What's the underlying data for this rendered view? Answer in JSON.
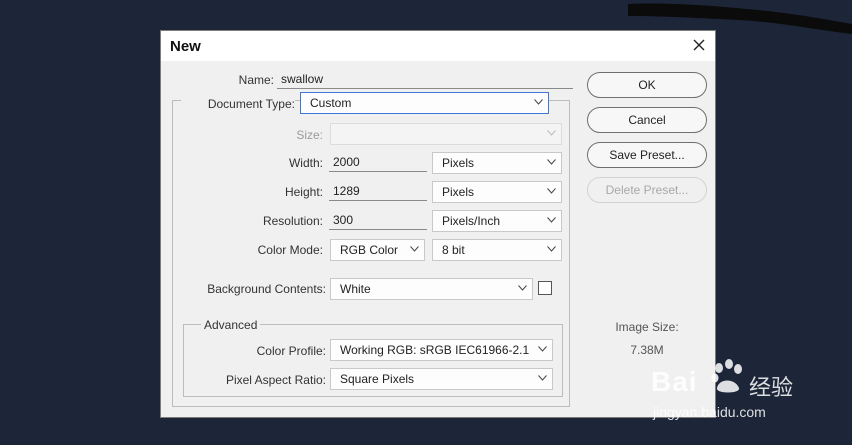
{
  "dialog": {
    "title": "New",
    "name_label": "Name:",
    "name_value": "swallow",
    "document_type_label": "Document Type:",
    "document_type_value": "Custom",
    "size_label": "Size:",
    "size_value": "",
    "width_label": "Width:",
    "width_value": "2000",
    "width_unit": "Pixels",
    "height_label": "Height:",
    "height_value": "1289",
    "height_unit": "Pixels",
    "resolution_label": "Resolution:",
    "resolution_value": "300",
    "resolution_unit": "Pixels/Inch",
    "color_mode_label": "Color Mode:",
    "color_mode_value": "RGB Color",
    "bit_depth_value": "8 bit",
    "background_label": "Background Contents:",
    "background_value": "White",
    "advanced_label": "Advanced",
    "color_profile_label": "Color Profile:",
    "color_profile_value": "Working RGB:  sRGB IEC61966-2.1",
    "pixel_aspect_label": "Pixel Aspect Ratio:",
    "pixel_aspect_value": "Square Pixels"
  },
  "buttons": {
    "ok": "OK",
    "cancel": "Cancel",
    "save_preset": "Save Preset...",
    "delete_preset": "Delete Preset..."
  },
  "image_size": {
    "label": "Image Size:",
    "value": "7.38M"
  },
  "watermark": {
    "brand": "Bai",
    "brand_cn": "经验",
    "url": "jingyan.baidu.com"
  },
  "icons": {
    "close": "close-icon",
    "dropdown": "chevron-down-icon",
    "paw": "paw-icon"
  },
  "colors": {
    "background": "#1d2638",
    "dialog": "#f0f0f0",
    "focus": "#3c78d8"
  }
}
